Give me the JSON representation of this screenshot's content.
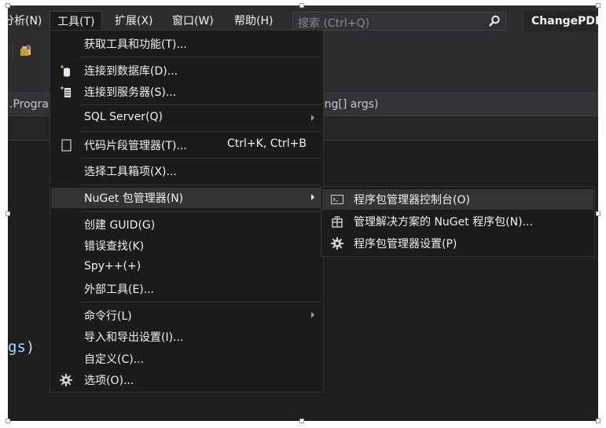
{
  "menubar": {
    "items": [
      {
        "label": "分析(N)"
      },
      {
        "label": "工具(T)"
      },
      {
        "label": "扩展(X)"
      },
      {
        "label": "窗口(W)"
      },
      {
        "label": "帮助(H)"
      }
    ],
    "search_placeholder": "搜索 (Ctrl+Q)",
    "window_title": "ChangePDF"
  },
  "navbar": {
    "left_text": ".Progra",
    "right_text": "ring[] args)"
  },
  "code_fragment": {
    "text": "gs",
    "paren": ")"
  },
  "tools_menu": {
    "items": [
      {
        "label": "获取工具和功能(T)..."
      },
      {
        "label": "连接到数据库(D)..."
      },
      {
        "label": "连接到服务器(S)..."
      },
      {
        "label": "SQL Server(Q)"
      },
      {
        "label": "代码片段管理器(T)...",
        "shortcut": "Ctrl+K, Ctrl+B"
      },
      {
        "label": "选择工具箱项(X)..."
      },
      {
        "label": "NuGet 包管理器(N)"
      },
      {
        "label": "创建 GUID(G)"
      },
      {
        "label": "错误查找(K)"
      },
      {
        "label": "Spy++(+)"
      },
      {
        "label": "外部工具(E)..."
      },
      {
        "label": "命令行(L)"
      },
      {
        "label": "导入和导出设置(I)..."
      },
      {
        "label": "自定义(C)..."
      },
      {
        "label": "选项(O)..."
      }
    ]
  },
  "nuget_submenu": {
    "items": [
      {
        "label": "程序包管理器控制台(O)"
      },
      {
        "label": "管理解决方案的 NuGet 程序包(N)..."
      },
      {
        "label": "程序包管理器设置(P)"
      }
    ]
  },
  "colors": {
    "background": "#1e1e1e",
    "menu_bg": "#1b1b1c",
    "highlight": "#333334",
    "text": "#f1f1f1",
    "code_identifier": "#9cdcfe"
  }
}
